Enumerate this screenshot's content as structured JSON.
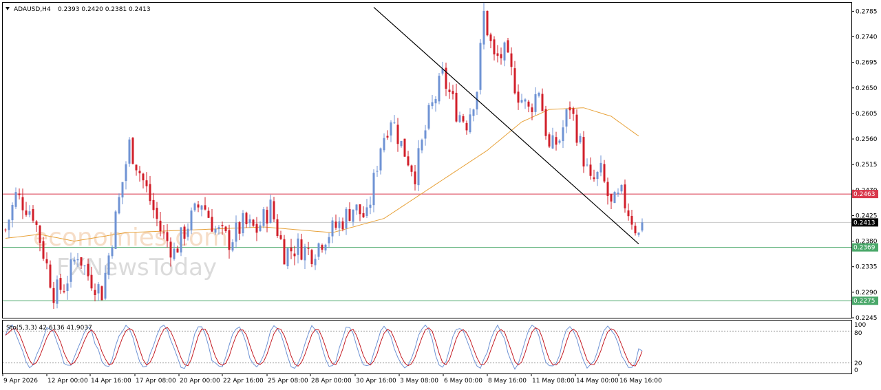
{
  "header": {
    "symbol": "ADAUSD,H4",
    "ohlc": "0.2393 0.2420 0.2381 0.2413"
  },
  "watermark": {
    "line1": "economies.com",
    "line2": "FXNewsToday"
  },
  "indicator": {
    "label": "Sto(5,3,3) 42.6136 41.9037",
    "levels": [
      100,
      80,
      20,
      0
    ]
  },
  "colors": {
    "bull": "#6f93d4",
    "bear": "#d11f2a",
    "ma": "#e8a33c",
    "resistance": "#d9384c",
    "support": "#4aa86a",
    "current": "#000000",
    "stoch_main": "#6f93d4",
    "stoch_signal": "#c41c24"
  },
  "chart_data": {
    "type": "candlestick",
    "symbol": "ADAUSD",
    "timeframe": "H4",
    "ylim": [
      0.2245,
      0.28
    ],
    "y_ticks": [
      0.2785,
      0.274,
      0.2695,
      0.265,
      0.2605,
      0.256,
      0.2515,
      0.247,
      0.2425,
      0.238,
      0.2335,
      0.229,
      0.2245
    ],
    "x_ticks": [
      "9 Apr 2026",
      "12 Apr 00:00",
      "14 Apr 16:00",
      "17 Apr 08:00",
      "20 Apr 00:00",
      "22 Apr 16:00",
      "25 Apr 08:00",
      "28 Apr 00:00",
      "30 Apr 16:00",
      "3 May 08:00",
      "6 May 00:00",
      "8 May 16:00",
      "11 May 08:00",
      "14 May 00:00",
      "16 May 16:00"
    ],
    "horizontal_lines": [
      {
        "price": 0.2463,
        "label": "0.2463",
        "role": "resistance"
      },
      {
        "price": 0.2413,
        "label": "0.2413",
        "role": "current"
      },
      {
        "price": 0.2369,
        "label": "0.2369",
        "role": "support"
      },
      {
        "price": 0.2275,
        "label": "0.2275",
        "role": "support"
      }
    ],
    "trendline": {
      "from": {
        "bar": 107,
        "price": 0.2792
      },
      "to": {
        "bar": 184,
        "price": 0.2375
      }
    },
    "key_points": [
      {
        "bar": 0,
        "price": 0.24
      },
      {
        "bar": 3,
        "price": 0.246
      },
      {
        "bar": 8,
        "price": 0.243
      },
      {
        "bar": 14,
        "price": 0.229
      },
      {
        "bar": 17,
        "price": 0.23
      },
      {
        "bar": 21,
        "price": 0.236
      },
      {
        "bar": 24,
        "price": 0.232
      },
      {
        "bar": 28,
        "price": 0.229
      },
      {
        "bar": 32,
        "price": 0.242
      },
      {
        "bar": 36,
        "price": 0.255
      },
      {
        "bar": 41,
        "price": 0.247
      },
      {
        "bar": 45,
        "price": 0.24
      },
      {
        "bar": 49,
        "price": 0.236
      },
      {
        "bar": 53,
        "price": 0.241
      },
      {
        "bar": 57,
        "price": 0.245
      },
      {
        "bar": 61,
        "price": 0.24
      },
      {
        "bar": 65,
        "price": 0.238
      },
      {
        "bar": 69,
        "price": 0.241
      },
      {
        "bar": 73,
        "price": 0.24
      },
      {
        "bar": 77,
        "price": 0.244
      },
      {
        "bar": 81,
        "price": 0.236
      },
      {
        "bar": 85,
        "price": 0.237
      },
      {
        "bar": 89,
        "price": 0.236
      },
      {
        "bar": 93,
        "price": 0.239
      },
      {
        "bar": 97,
        "price": 0.241
      },
      {
        "bar": 101,
        "price": 0.244
      },
      {
        "bar": 105,
        "price": 0.242
      },
      {
        "bar": 109,
        "price": 0.255
      },
      {
        "bar": 112,
        "price": 0.26
      },
      {
        "bar": 115,
        "price": 0.255
      },
      {
        "bar": 119,
        "price": 0.25
      },
      {
        "bar": 123,
        "price": 0.26
      },
      {
        "bar": 127,
        "price": 0.267
      },
      {
        "bar": 131,
        "price": 0.261
      },
      {
        "bar": 134,
        "price": 0.259
      },
      {
        "bar": 137,
        "price": 0.265
      },
      {
        "bar": 139,
        "price": 0.278
      },
      {
        "bar": 142,
        "price": 0.27
      },
      {
        "bar": 145,
        "price": 0.271
      },
      {
        "bar": 149,
        "price": 0.264
      },
      {
        "bar": 152,
        "price": 0.261
      },
      {
        "bar": 155,
        "price": 0.265
      },
      {
        "bar": 158,
        "price": 0.254
      },
      {
        "bar": 161,
        "price": 0.256
      },
      {
        "bar": 164,
        "price": 0.262
      },
      {
        "bar": 167,
        "price": 0.255
      },
      {
        "bar": 170,
        "price": 0.248
      },
      {
        "bar": 173,
        "price": 0.25
      },
      {
        "bar": 176,
        "price": 0.244
      },
      {
        "bar": 179,
        "price": 0.246
      },
      {
        "bar": 182,
        "price": 0.242
      },
      {
        "bar": 184,
        "price": 0.239
      },
      {
        "bar": 185,
        "price": 0.2413
      }
    ],
    "ma_points": [
      {
        "bar": 0,
        "price": 0.2385
      },
      {
        "bar": 10,
        "price": 0.2392
      },
      {
        "bar": 20,
        "price": 0.238
      },
      {
        "bar": 35,
        "price": 0.2395
      },
      {
        "bar": 55,
        "price": 0.24
      },
      {
        "bar": 75,
        "price": 0.2405
      },
      {
        "bar": 95,
        "price": 0.2395
      },
      {
        "bar": 110,
        "price": 0.242
      },
      {
        "bar": 125,
        "price": 0.248
      },
      {
        "bar": 140,
        "price": 0.254
      },
      {
        "bar": 150,
        "price": 0.259
      },
      {
        "bar": 158,
        "price": 0.2612
      },
      {
        "bar": 168,
        "price": 0.2615
      },
      {
        "bar": 176,
        "price": 0.26
      },
      {
        "bar": 184,
        "price": 0.2565
      }
    ],
    "stoch_range": [
      0,
      100
    ]
  }
}
